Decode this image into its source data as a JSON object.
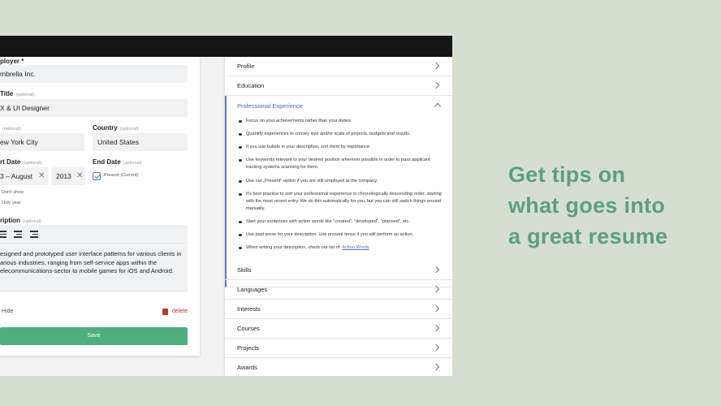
{
  "form": {
    "employer_label": "ployer",
    "employer_required": "*",
    "employer_value": "mbrella Inc.",
    "jobtitle_label": "Title",
    "optional": "(optional)",
    "jobtitle_value": "X & UI Designer",
    "city_label": "",
    "city_value": "ew York City",
    "country_label": "Country",
    "country_value": "United States",
    "start_label": "rt Date",
    "start_month_value": "3 – August",
    "start_year_value": "2013",
    "end_label": "End Date",
    "present_label": "Present (Current)",
    "dont_show": "Don't show",
    "only_year": "Only year",
    "description_label": "ription",
    "description_lines": [
      "esigned and prototyped user interface patterns for various clients in",
      "arious industries, ranging from self-service apps within the",
      "elecommunications-sector to mobile games for iOS and Android."
    ],
    "hide_label": "Hide",
    "delete_label": "delete",
    "save_label": "Save"
  },
  "accordion": {
    "top_items": [
      "Profile",
      "Education"
    ],
    "open_title": "Professional Experience",
    "tips": [
      "Focus on your achievements rather than your duties.",
      "Quantify experiences to convey size and/or scale of projects, budgets and results.",
      "If you use bullets in your description, sort them by importance.",
      "Use keywords relevant to your desired position wherever possible in order to pass applicant tracking systems scanning for them.",
      "Use our „Present“-option if you are still employed at the company.",
      "It's best practice to sort your professional experience in chronologically descending order, starting with the most recent entry. We do this automatically for you, but you can still switch things around manually.",
      "Start your sentences with action words like \"created\", \"developed\", \"planned\", etc.",
      "Use past tense for your description. Use present tense if you still perform an action.",
      "When writing your description, check our list of"
    ],
    "tip_link": "Action Words",
    "bottom_items": [
      "Skills",
      "Languages",
      "Interests",
      "Courses",
      "Projects",
      "Awards"
    ]
  },
  "tagline": [
    "Get tips on",
    "what goes into",
    "a great resume"
  ],
  "colors": {
    "accent_green": "#4fae7f",
    "tagline": "#5c9e84",
    "link_blue": "#4a6ac0",
    "delete_red": "#b33a2a"
  }
}
